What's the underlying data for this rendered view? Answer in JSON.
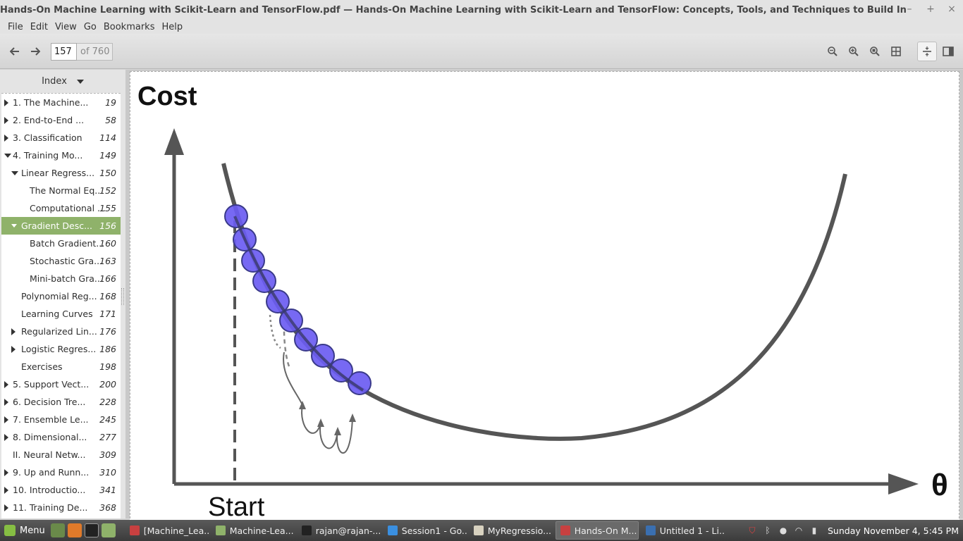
{
  "window": {
    "title": "Hands-On Machine Learning with Scikit-Learn and TensorFlow.pdf — Hands-On Machine Learning with Scikit-Learn and TensorFlow: Concepts, Tools, and Techniques to Build Intelligent Systems",
    "minimize": "–",
    "maximize": "+",
    "close": "×"
  },
  "menubar": [
    "File",
    "Edit",
    "View",
    "Go",
    "Bookmarks",
    "Help"
  ],
  "toolbar": {
    "current_page": "157",
    "page_total": "of 760",
    "icons": [
      "back-arrow-icon",
      "forward-arrow-icon",
      "zoom-out-icon",
      "zoom-in-icon",
      "zoom-fit-icon",
      "best-fit-icon",
      "continuous-view-icon",
      "dual-page-icon"
    ]
  },
  "sidebar": {
    "header": "Index",
    "items": [
      {
        "label": "1. The Machine...",
        "page": "19",
        "level": 0,
        "expander": "collapsed"
      },
      {
        "label": "2. End-to-End ...",
        "page": "58",
        "level": 0,
        "expander": "collapsed"
      },
      {
        "label": "3. Classification",
        "page": "114",
        "level": 0,
        "expander": "collapsed"
      },
      {
        "label": "4. Training Mo...",
        "page": "149",
        "level": 0,
        "expander": "expanded"
      },
      {
        "label": "Linear Regress...",
        "page": "150",
        "level": 1,
        "expander": "expanded"
      },
      {
        "label": "The Normal Eq...",
        "page": "152",
        "level": 2,
        "expander": "none"
      },
      {
        "label": "Computational ...",
        "page": "155",
        "level": 2,
        "expander": "none"
      },
      {
        "label": "Gradient Desc...",
        "page": "156",
        "level": 1,
        "expander": "expanded",
        "selected": true
      },
      {
        "label": "Batch Gradient...",
        "page": "160",
        "level": 2,
        "expander": "none"
      },
      {
        "label": "Stochastic Gra...",
        "page": "163",
        "level": 2,
        "expander": "none"
      },
      {
        "label": "Mini-batch Gra...",
        "page": "166",
        "level": 2,
        "expander": "none"
      },
      {
        "label": "Polynomial Reg...",
        "page": "168",
        "level": 1,
        "expander": "none"
      },
      {
        "label": "Learning Curves",
        "page": "171",
        "level": 1,
        "expander": "none"
      },
      {
        "label": "Regularized Lin...",
        "page": "176",
        "level": 1,
        "expander": "collapsed"
      },
      {
        "label": "Logistic Regres...",
        "page": "186",
        "level": 1,
        "expander": "collapsed"
      },
      {
        "label": "Exercises",
        "page": "198",
        "level": 1,
        "expander": "none"
      },
      {
        "label": "5. Support Vect...",
        "page": "200",
        "level": 0,
        "expander": "collapsed"
      },
      {
        "label": "6. Decision Tre...",
        "page": "228",
        "level": 0,
        "expander": "collapsed"
      },
      {
        "label": "7. Ensemble Le...",
        "page": "245",
        "level": 0,
        "expander": "collapsed"
      },
      {
        "label": "8. Dimensional...",
        "page": "277",
        "level": 0,
        "expander": "collapsed"
      },
      {
        "label": "II. Neural Netw...",
        "page": "309",
        "level": 0,
        "expander": "none"
      },
      {
        "label": "9. Up and Runn...",
        "page": "310",
        "level": 0,
        "expander": "collapsed"
      },
      {
        "label": "10. Introductio...",
        "page": "341",
        "level": 0,
        "expander": "collapsed"
      },
      {
        "label": "11. Training De...",
        "page": "368",
        "level": 0,
        "expander": "collapsed"
      }
    ]
  },
  "figure": {
    "ylabel": "Cost",
    "xlabel": "θ",
    "start_label": "Start",
    "colors": {
      "axis": "#555555",
      "curve": "#555555",
      "step_fill": "#6b5cf2",
      "step_stroke": "#3a3a8a"
    }
  },
  "taskbar": {
    "menu_label": "Menu",
    "tasks": [
      {
        "label": "[Machine_Lea...",
        "icon": "pdf-viewer-icon",
        "active": false
      },
      {
        "label": "Machine-Lea...",
        "icon": "folder-icon",
        "active": false
      },
      {
        "label": "rajan@rajan-...",
        "icon": "terminal-icon",
        "active": false
      },
      {
        "label": "Session1 - Go...",
        "icon": "chrome-icon",
        "active": false
      },
      {
        "label": "MyRegressio...",
        "icon": "text-editor-icon",
        "active": false
      },
      {
        "label": "Hands-On M...",
        "icon": "pdf-viewer-icon",
        "active": true
      },
      {
        "label": "Untitled 1 - Li...",
        "icon": "libreoffice-icon",
        "active": false
      }
    ],
    "clock": "Sunday November  4,  5:45 PM"
  }
}
